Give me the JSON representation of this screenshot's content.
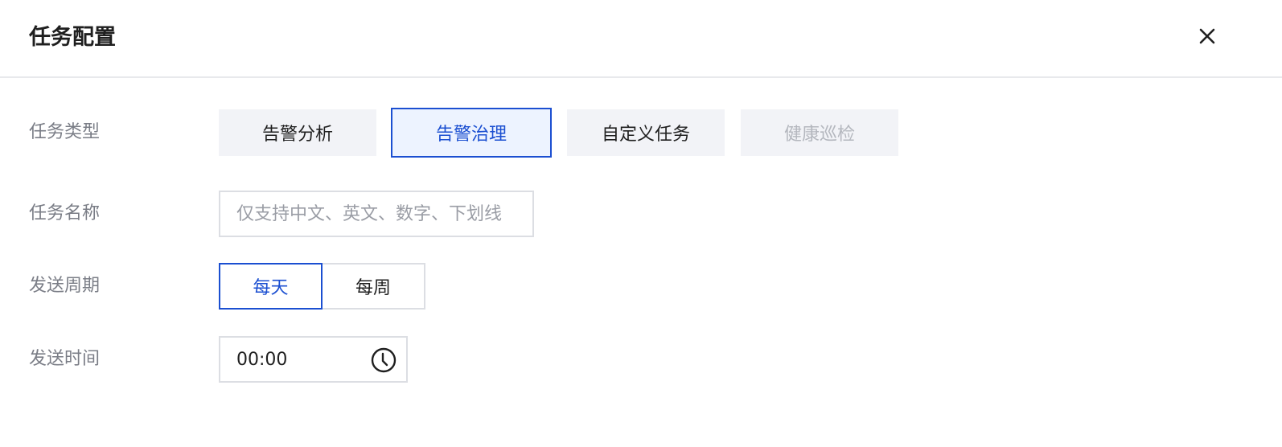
{
  "dialog": {
    "title": "任务配置",
    "close_icon": "close-icon"
  },
  "form": {
    "task_type": {
      "label": "任务类型",
      "options": [
        "告警分析",
        "告警治理",
        "自定义任务",
        "健康巡检"
      ],
      "selected": "告警治理",
      "disabled": [
        "健康巡检"
      ]
    },
    "task_name": {
      "label": "任务名称",
      "value": "",
      "placeholder": "仅支持中文、英文、数字、下划线"
    },
    "send_cycle": {
      "label": "发送周期",
      "options": [
        "每天",
        "每周"
      ],
      "selected": "每天"
    },
    "send_time": {
      "label": "发送时间",
      "value": "00:00",
      "icon": "clock-icon"
    }
  },
  "colors": {
    "accent": "#1b4fd1",
    "label_text": "#7a7d86",
    "disabled_text": "#b4b7be",
    "button_bg": "#f2f3f7",
    "border": "#dcdee3"
  }
}
